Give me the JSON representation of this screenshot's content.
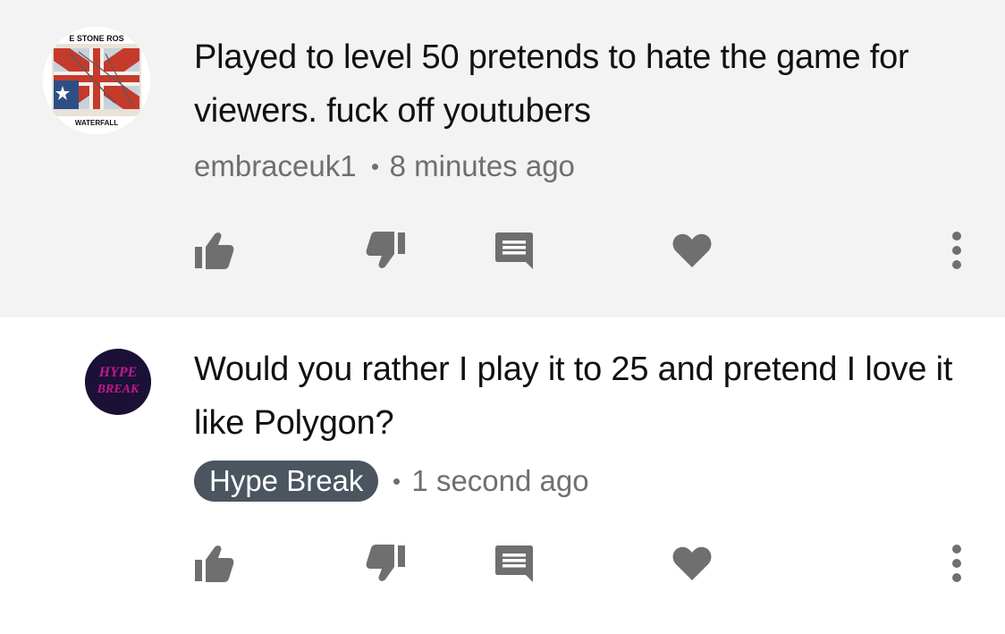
{
  "comments": [
    {
      "avatar_text_top": "E STONE ROS",
      "avatar_text_bottom": "WATERFALL",
      "text": "Played to level 50 pretends to hate the game for viewers. fuck off youtubers",
      "author": "embraceuk1",
      "time": "8 minutes ago",
      "author_is_badge": false
    },
    {
      "avatar_text_top": "HYPE",
      "avatar_text_bottom": "BREAK",
      "text": "Would you rather I play it to 25 and pretend I love it like Polygon?",
      "author": "Hype Break",
      "time": "1 second ago",
      "author_is_badge": true
    }
  ],
  "actions": {
    "like": "thumbs-up-icon",
    "dislike": "thumbs-down-icon",
    "reply": "reply-comment-icon",
    "heart": "heart-icon",
    "more": "more-vertical-icon"
  },
  "colors": {
    "top_background": "#f3f3f3",
    "icon_gray": "#6f6f6f",
    "badge_background": "#4a5560"
  }
}
